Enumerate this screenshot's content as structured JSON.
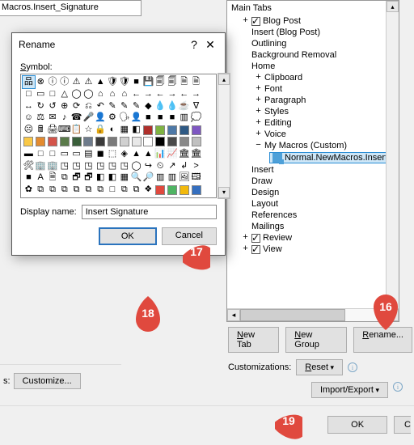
{
  "left_fragment": "Macros.Insert_Signature",
  "tree": {
    "header": "Main Tabs",
    "items": [
      {
        "label": "Blog Post",
        "indent": 1,
        "tw": "+",
        "checked": true
      },
      {
        "label": "Insert (Blog Post)",
        "indent": 1,
        "tw": ""
      },
      {
        "label": "Outlining",
        "indent": 1,
        "tw": ""
      },
      {
        "label": "Background Removal",
        "indent": 1,
        "tw": ""
      },
      {
        "label": "Home",
        "indent": 1,
        "tw": ""
      },
      {
        "label": "Clipboard",
        "indent": 2,
        "tw": "+"
      },
      {
        "label": "Font",
        "indent": 2,
        "tw": "+"
      },
      {
        "label": "Paragraph",
        "indent": 2,
        "tw": "+"
      },
      {
        "label": "Styles",
        "indent": 2,
        "tw": "+"
      },
      {
        "label": "Editing",
        "indent": 2,
        "tw": "+"
      },
      {
        "label": "Voice",
        "indent": 2,
        "tw": "+"
      },
      {
        "label": "My Macros (Custom)",
        "indent": 2,
        "tw": "−",
        "hasChild": true
      },
      {
        "label": "Insert",
        "indent": 1,
        "tw": ""
      },
      {
        "label": "Draw",
        "indent": 1,
        "tw": ""
      },
      {
        "label": "Design",
        "indent": 1,
        "tw": ""
      },
      {
        "label": "Layout",
        "indent": 1,
        "tw": ""
      },
      {
        "label": "References",
        "indent": 1,
        "tw": ""
      },
      {
        "label": "Mailings",
        "indent": 1,
        "tw": ""
      },
      {
        "label": "Review",
        "indent": 1,
        "tw": "+",
        "checked": true
      },
      {
        "label": "View",
        "indent": 1,
        "tw": "+",
        "checked": true
      }
    ],
    "selected_child": "Normal.NewMacros.Insert_"
  },
  "tab_buttons": {
    "new_tab": "New Tab",
    "new_group": "New Group",
    "rename": "Rename..."
  },
  "customizations": {
    "label": "Customizations:",
    "reset": "Reset",
    "import_export": "Import/Export"
  },
  "left_customize": {
    "label": "s:",
    "button": "Customize..."
  },
  "parent_buttons": {
    "ok": "OK",
    "cancel_stub": "C"
  },
  "dialog": {
    "title": "Rename",
    "symbol_label": "Symbol:",
    "display_name_label": "Display name:",
    "display_name_value": "Insert Signature",
    "ok": "OK",
    "cancel": "Cancel"
  },
  "symbols_rows": [
    [
      "sel:品",
      "⊗",
      "ⓘ",
      "ⓘ",
      "⚠",
      "⚠",
      "▲",
      "🛡",
      "🛡",
      "■",
      "💾",
      "🗐",
      "🗐",
      "🗎",
      "🗎"
    ],
    [
      "□",
      "▭",
      "□",
      "△",
      "◯",
      "◯",
      "⌂",
      "⌂",
      "⌂",
      "←",
      "→",
      "←",
      "→",
      "←",
      "→"
    ],
    [
      "↔",
      "↻",
      "↺",
      "⊕",
      "⟳",
      "⎌",
      "↶",
      "✎",
      "✎",
      "✎",
      "◆",
      "💧",
      "💧",
      "☕",
      "∇"
    ],
    [
      "☺",
      "⚖",
      "✉",
      "♪",
      "☎",
      "🎤",
      "👤",
      "⚙",
      "🗣",
      "👤",
      "■",
      "■",
      "■",
      "▥",
      "💭"
    ],
    [
      "☹",
      "🖩",
      "🖨",
      "⌨",
      "📋",
      "☆",
      "🔒",
      "◐",
      "▦",
      "◧",
      "col:#b0302c",
      "col:#7fb342",
      "col:#4e79a7",
      "col:#2e5984",
      "col:#7e57c2"
    ],
    [
      "col:#f9c846",
      "col:#e38b2f",
      "col:#d4544a",
      "col:#5a7a4a",
      "col:#3a5f3a",
      "col:#6e7b8b",
      "col:#3a3a3a",
      "col:#7a7a7a",
      "col:#d0d0d0",
      "col:#e8e8e8",
      "col:#ffffff",
      "col:#000000",
      "col:#4a4a4a",
      "col:#888888",
      "col:#c0c0c0"
    ],
    [
      "▬",
      "□",
      "□",
      "▭",
      "▭",
      "▤",
      "◼",
      "⬚",
      "◈",
      "▲",
      "▲",
      "📊",
      "📈",
      "🏛",
      "🏛"
    ],
    [
      "🛠",
      "🏢",
      "🏢",
      "◳",
      "◳",
      "◳",
      "◳",
      "◳",
      "◳",
      "◯",
      "↪",
      "⏲",
      "↗",
      "↲",
      ">"
    ],
    [
      "■",
      "A",
      "🗎",
      "⧉",
      "🗗",
      "🗗",
      "◧",
      "◧",
      "▦",
      "🔍",
      "🔎",
      "▥",
      "▥",
      "🖼",
      "🖽"
    ],
    [
      "✿",
      "⧉",
      "⧉",
      "⧉",
      "⧉",
      "⧉",
      "⧉",
      "□",
      "⧉",
      "⧉",
      "❖",
      "col:#e0493e",
      "col:#4fb463",
      "col:#f2b90c",
      "col:#356fbf"
    ]
  ],
  "markers": {
    "m16": "16",
    "m17": "17",
    "m18": "18",
    "m19": "19"
  },
  "colors": {
    "accent": "#2a73bd",
    "marker": "#e0493e"
  }
}
